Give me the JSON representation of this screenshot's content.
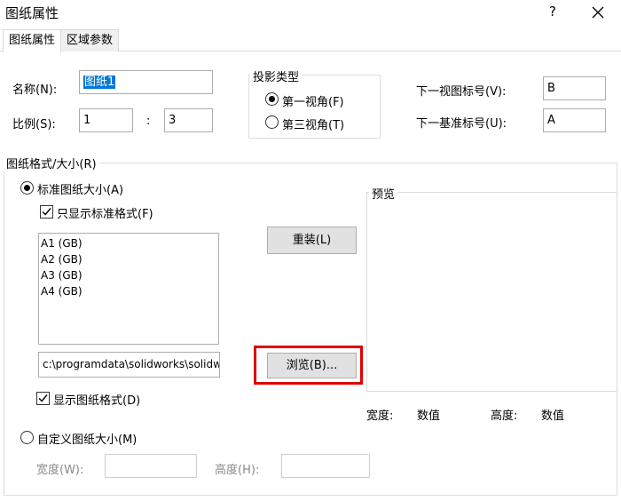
{
  "window": {
    "title": "图纸属性",
    "help": "?",
    "close": "✕"
  },
  "tabs": [
    {
      "label": "图纸属性",
      "active": true
    },
    {
      "label": "区域参数",
      "active": false
    }
  ],
  "name": {
    "label": "名称(N):",
    "value": "图纸1"
  },
  "scale": {
    "label": "比例(S):",
    "left": "1",
    "separator": ":",
    "right": "3"
  },
  "projection": {
    "label": "投影类型",
    "options": [
      {
        "label": "第一视角(F)",
        "selected": true
      },
      {
        "label": "第三视角(T)",
        "selected": false
      }
    ]
  },
  "next_view_label": {
    "label": "下一视图标号(V):",
    "value": "B"
  },
  "next_datum_label": {
    "label": "下一基准标号(U):",
    "value": "A"
  },
  "sheet_format": {
    "label": "图纸格式/大小(R)",
    "standard_radio": "标准图纸大小(A)",
    "only_standard_check": "只显示标准格式(F)",
    "sizes": [
      "A1 (GB)",
      "A2 (GB)",
      "A3 (GB)",
      "A4 (GB)"
    ],
    "reload_button": "重装(L)",
    "path": "c:\\programdata\\solidworks\\solidwork",
    "browse_button": "浏览(B)...",
    "show_format_check": "显示图纸格式(D)",
    "custom_radio": "自定义图纸大小(M)",
    "custom_width_label": "宽度(W):",
    "custom_height_label": "高度(H):"
  },
  "preview": {
    "label": "预览",
    "width_label": "宽度:",
    "width_value": "数值",
    "height_label": "高度:",
    "height_value": "数值"
  },
  "colors": {
    "highlight": "#e00000",
    "selection": "#0078d7"
  }
}
